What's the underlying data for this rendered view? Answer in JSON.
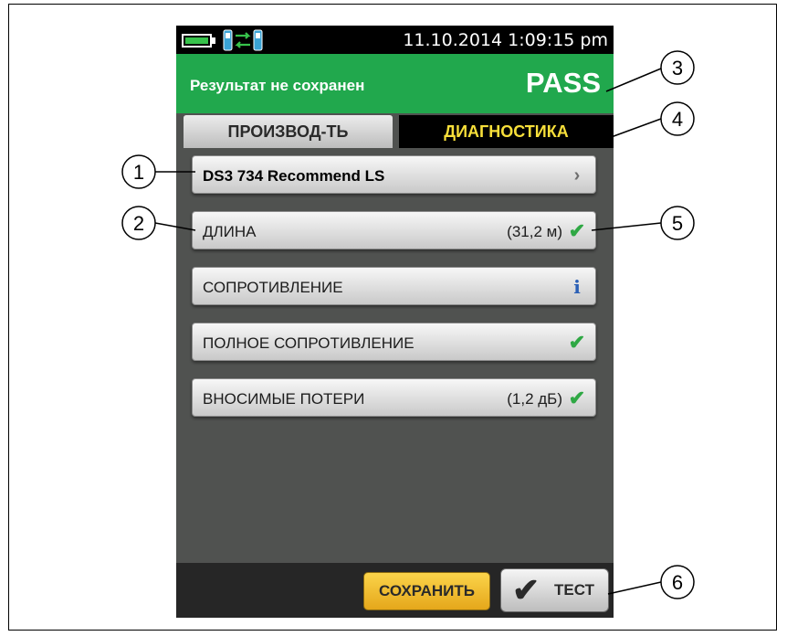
{
  "status_bar": {
    "datetime": "11.10.2014 1:09:15 pm",
    "battery_icon": "battery-full-icon",
    "link_icon": "remote-link-icon"
  },
  "result": {
    "message": "Результат не сохранен",
    "status": "PASS",
    "color": "#21a84d"
  },
  "tabs": [
    {
      "label": "ПРОИЗВОД-ТЬ",
      "active": false
    },
    {
      "label": "ДИАГНОСТИКА",
      "active": true
    }
  ],
  "rows": [
    {
      "label": "DS3 734 Recommend LS",
      "value": "",
      "icon": "chevron-right-icon"
    },
    {
      "label": "ДЛИНА",
      "value": "(31,2 м)",
      "icon": "check-icon"
    },
    {
      "label": "СОПРОТИВЛЕНИЕ",
      "value": "",
      "icon": "info-icon"
    },
    {
      "label": "ПОЛНОЕ СОПРОТИВЛЕНИЕ",
      "value": "",
      "icon": "check-icon"
    },
    {
      "label": "ВНОСИМЫЕ ПОТЕРИ",
      "value": "(1,2 дБ)",
      "icon": "check-icon"
    }
  ],
  "footer": {
    "save_label": "СОХРАНИТЬ",
    "test_label": "ТЕСТ"
  },
  "callouts": [
    "1",
    "2",
    "3",
    "4",
    "5",
    "6"
  ],
  "glyphs": {
    "chevron": "›",
    "check": "✔",
    "info": "i"
  },
  "colors": {
    "accent_yellow": "#f7df3a",
    "pass_green": "#21a84d",
    "check_green": "#2fa844",
    "info_blue": "#2a5fb5",
    "save_button": "#f2bf2e"
  }
}
